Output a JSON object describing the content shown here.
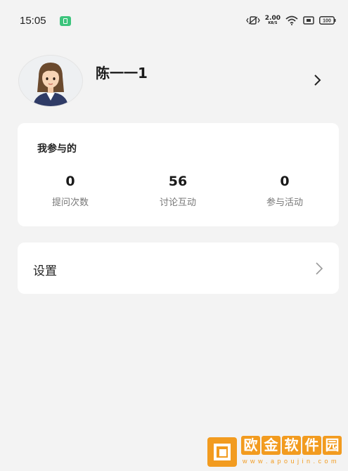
{
  "status_bar": {
    "time": "15:05",
    "net_speed_value": "2.00",
    "net_speed_unit": "KB/S",
    "battery": "100"
  },
  "profile": {
    "name": "陈一一1"
  },
  "stats": {
    "title": "我参与的",
    "items": [
      {
        "value": "0",
        "label": "提问次数"
      },
      {
        "value": "56",
        "label": "讨论互动"
      },
      {
        "value": "0",
        "label": "参与活动"
      }
    ]
  },
  "settings": {
    "label": "设置"
  },
  "watermark": {
    "chars": [
      "欧",
      "金",
      "软",
      "件",
      "园"
    ],
    "url": "w w w . a p o u j i n . c o m"
  },
  "colors": {
    "background": "#f3f3f3",
    "card": "#ffffff",
    "notification_green": "#3cc47c",
    "watermark_orange": "#f29b1f"
  }
}
